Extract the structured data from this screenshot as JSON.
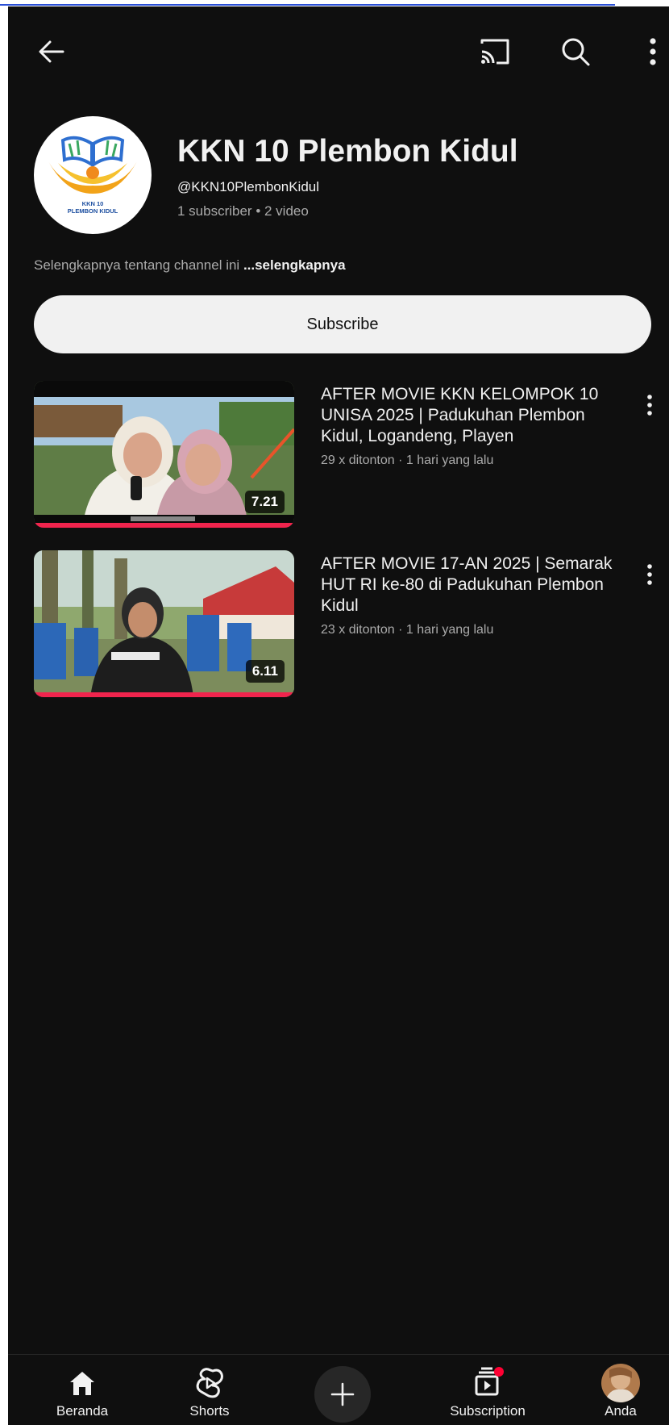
{
  "channel": {
    "name": "KKN 10 Plembon Kidul",
    "handle": "@KKN10PlembonKidul",
    "stats": "1 subscriber • 2 video",
    "about_text": "Selengkapnya tentang channel ini ",
    "about_more": "...selengkapnya",
    "logo_text_line1": "KKN 10",
    "logo_text_line2": "PLEMBON KIDUL"
  },
  "subscribe_label": "Subscribe",
  "videos": [
    {
      "title": "AFTER MOVIE KKN KELOMPOK 10 UNISA 2025 | Padukuhan Plembon Kidul, Logandeng, Playen",
      "meta": "29 x ditonton · 1 hari yang lalu",
      "duration": "7.21",
      "progress": 1.0
    },
    {
      "title": "AFTER MOVIE 17-AN 2025 | Semarak HUT RI ke-80 di Padukuhan Plembon Kidul",
      "meta": "23 x ditonton · 1 hari yang lalu",
      "duration": "6.11",
      "progress": 1.0
    }
  ],
  "nav": {
    "home": "Beranda",
    "shorts": "Shorts",
    "subscriptions": "Subscription",
    "you": "Anda"
  },
  "colors": {
    "background": "#0f0f0f",
    "text_primary": "#f1f1f1",
    "text_secondary": "#aaaaaa",
    "subscribe_bg": "#f1f1f1",
    "progress_red": "#f0244d",
    "notification_dot": "#ff0033"
  },
  "icons": [
    "back-arrow-icon",
    "cast-icon",
    "search-icon",
    "more-vert-icon",
    "home-icon",
    "shorts-icon",
    "create-plus-icon",
    "subscriptions-icon",
    "avatar"
  ]
}
